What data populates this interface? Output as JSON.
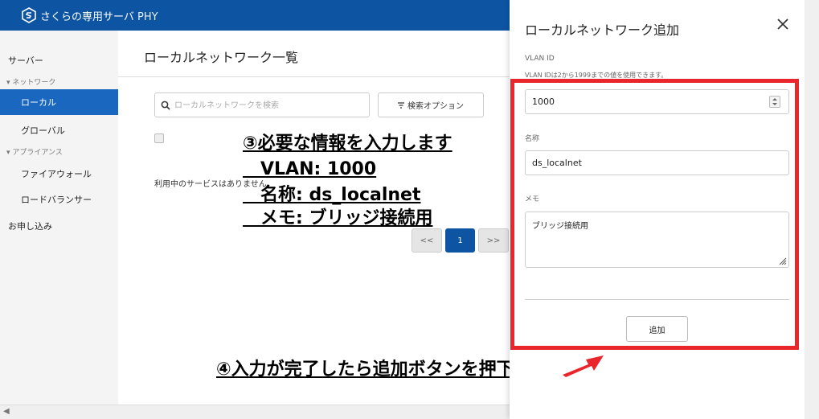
{
  "app": {
    "brand": "さくらの専用サーバ",
    "brand_suffix": "PHY"
  },
  "sidebar": {
    "server": "サーバー",
    "group_network": "▾ ネットワーク",
    "item_local": "ローカル",
    "item_global": "グローバル",
    "group_appliance": "▾ アプライアンス",
    "item_firewall": "ファイアウォール",
    "item_lb": "ロードバランサー",
    "apply": "お申し込み"
  },
  "main": {
    "title": "ローカルネットワーク一覧",
    "search_placeholder": "ローカルネットワークを検索",
    "search_options": "検索オプション",
    "empty_message": "利用中のサービスはありません。",
    "pager": {
      "prev": "<<",
      "current": "1",
      "next": ">>"
    }
  },
  "annotations": {
    "step3_line1": "③必要な情報を入力します",
    "step3_line2": "　VLAN: 1000",
    "step3_line3": "　名称: ds_localnet",
    "step3_line4": "　メモ: ブリッジ接続用",
    "step4": "④入力が完了したら追加ボタンを押下"
  },
  "drawer": {
    "title": "ローカルネットワーク追加",
    "vlan_label": "VLAN ID",
    "vlan_hint": "VLAN IDは2から1999までの値を使用できます。",
    "vlan_value": "1000",
    "name_label": "名称",
    "name_value": "ds_localnet",
    "memo_label": "メモ",
    "memo_value": "ブリッジ接続用",
    "add_button": "追加"
  },
  "colors": {
    "primary": "#0d55a3",
    "highlight": "#e8262c",
    "arrow": "#e8262c"
  },
  "icons": {
    "logo": "sakura-logo-icon",
    "search": "search-icon",
    "filter": "filter-icon",
    "close": "close-icon",
    "arrow": "arrow-icon"
  }
}
